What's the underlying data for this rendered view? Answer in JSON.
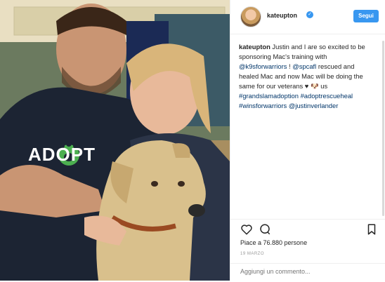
{
  "post": {
    "username": "kateupton",
    "follow_label": "Segui",
    "caption": {
      "author": "kateupton",
      "segments": [
        {
          "text": " Justin and I are so excited to be sponsoring Mac's training with ",
          "kind": "plain"
        },
        {
          "text": "@k9sforwarriors",
          "kind": "mention"
        },
        {
          "text": " ! ",
          "kind": "plain"
        },
        {
          "text": "@spcafl",
          "kind": "mention"
        },
        {
          "text": " rescued and healed Mac and now Mac will be doing the same for our veterans ♥ 🐶 us ",
          "kind": "plain"
        },
        {
          "text": "#grandslamadoption",
          "kind": "tag"
        },
        {
          "text": " ",
          "kind": "plain"
        },
        {
          "text": "#adoptrescueheal",
          "kind": "tag"
        },
        {
          "text": " ",
          "kind": "plain"
        },
        {
          "text": "#winsforwarriors",
          "kind": "tag"
        },
        {
          "text": " ",
          "kind": "plain"
        },
        {
          "text": "@justinverlander",
          "kind": "mention"
        }
      ]
    },
    "likes_text": "Piace a 76.880 persone",
    "date_text": "19 MARZO",
    "comment_placeholder": "Aggiungi un commento...",
    "photo_shirt_text": "ADOPT"
  },
  "icons": {
    "like": "heart-outline-icon",
    "comment": "speech-bubble-icon",
    "save": "bookmark-icon",
    "verified": "verified-badge-icon"
  },
  "colors": {
    "accent": "#3897f0",
    "hashtag": "#003569",
    "paw": "#4caf50"
  }
}
